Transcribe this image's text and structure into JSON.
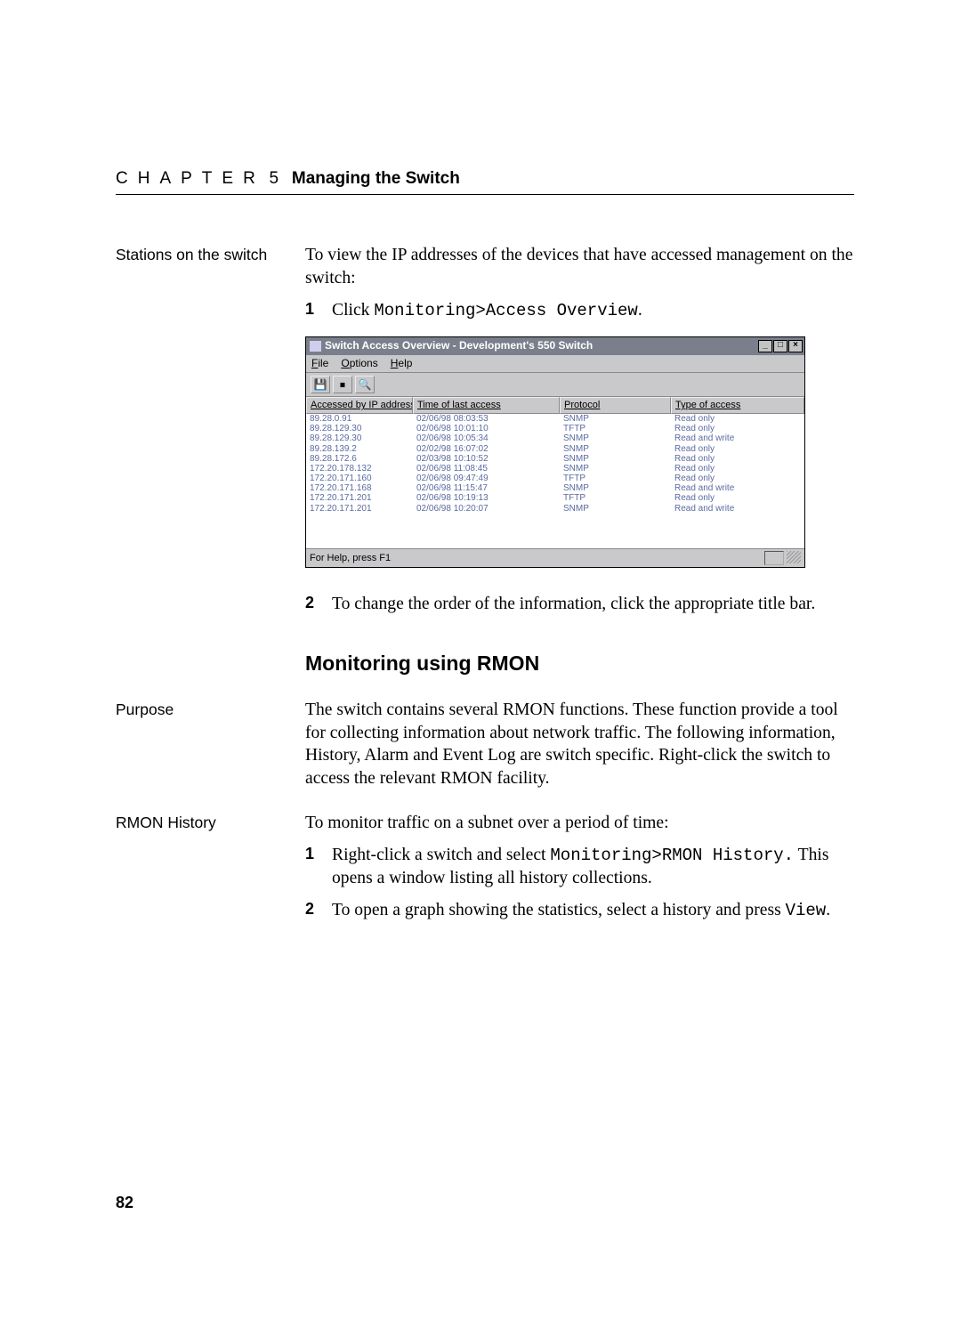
{
  "chapter": {
    "word": "CHAPTER",
    "number": "5",
    "title": "Managing the Switch"
  },
  "side": {
    "stations": "Stations on the switch",
    "purpose": "Purpose",
    "rmon_history": "RMON History"
  },
  "intro": {
    "stations_text": "To view the IP addresses of the devices that have accessed management on the switch:"
  },
  "list1": {
    "n1": "1",
    "t1a": "Click ",
    "t1b": "Monitoring>Access Overview",
    "t1c": "."
  },
  "shot": {
    "title": "Switch Access Overview - Development's 550 Switch",
    "menu": {
      "file": "File",
      "options": "Options",
      "help": "Help"
    },
    "toolbar": {
      "save": "💾",
      "stop": "⏹",
      "refresh": "🔍"
    },
    "headers": {
      "ip": "Accessed by IP address",
      "time": "Time of last access",
      "proto": "Protocol",
      "type": "Type of access"
    },
    "rows": [
      {
        "ip": "89.28.0.91",
        "time": "02/06/98 08:03:53",
        "proto": "SNMP",
        "type": "Read only"
      },
      {
        "ip": "89.28.129.30",
        "time": "02/06/98 10:01:10",
        "proto": "TFTP",
        "type": "Read only"
      },
      {
        "ip": "89.28.129.30",
        "time": "02/06/98 10:05:34",
        "proto": "SNMP",
        "type": "Read and write"
      },
      {
        "ip": "89.28.139.2",
        "time": "02/02/98 16:07:02",
        "proto": "SNMP",
        "type": "Read only"
      },
      {
        "ip": "89.28.172.6",
        "time": "02/03/98 10:10:52",
        "proto": "SNMP",
        "type": "Read only"
      },
      {
        "ip": "172.20.178.132",
        "time": "02/06/98 11:08:45",
        "proto": "SNMP",
        "type": "Read only"
      },
      {
        "ip": "172.20.171.160",
        "time": "02/06/98 09:47:49",
        "proto": "TFTP",
        "type": "Read only"
      },
      {
        "ip": "172.20.171.168",
        "time": "02/06/98 11:15:47",
        "proto": "SNMP",
        "type": "Read and write"
      },
      {
        "ip": "172.20.171.201",
        "time": "02/06/98 10:19:13",
        "proto": "TFTP",
        "type": "Read only"
      },
      {
        "ip": "172.20.171.201",
        "time": "02/06/98 10:20:07",
        "proto": "SNMP",
        "type": "Read and write"
      }
    ],
    "status": "For Help, press F1"
  },
  "list2": {
    "n2": "2",
    "t2": "To change the order of the information, click the appropriate title bar."
  },
  "rmon": {
    "heading": "Monitoring using RMON",
    "purpose_text": "The switch contains several RMON functions. These function provide a tool for collecting information about network traffic. The following information, History, Alarm and Event Log are switch specific. Right-click the switch to access the relevant RMON facility.",
    "history_intro": "To monitor traffic on a subnet over a period of time:"
  },
  "list3": {
    "n1": "1",
    "t1a": "Right-click a switch and select ",
    "t1b": "Monitoring>RMON History.",
    "t1c": "This opens a window listing all history collections.",
    "n2": "2",
    "t2a": "To open a graph showing the statistics, select a history and press ",
    "t2b": "View",
    "t2c": "."
  },
  "page_number": "82"
}
